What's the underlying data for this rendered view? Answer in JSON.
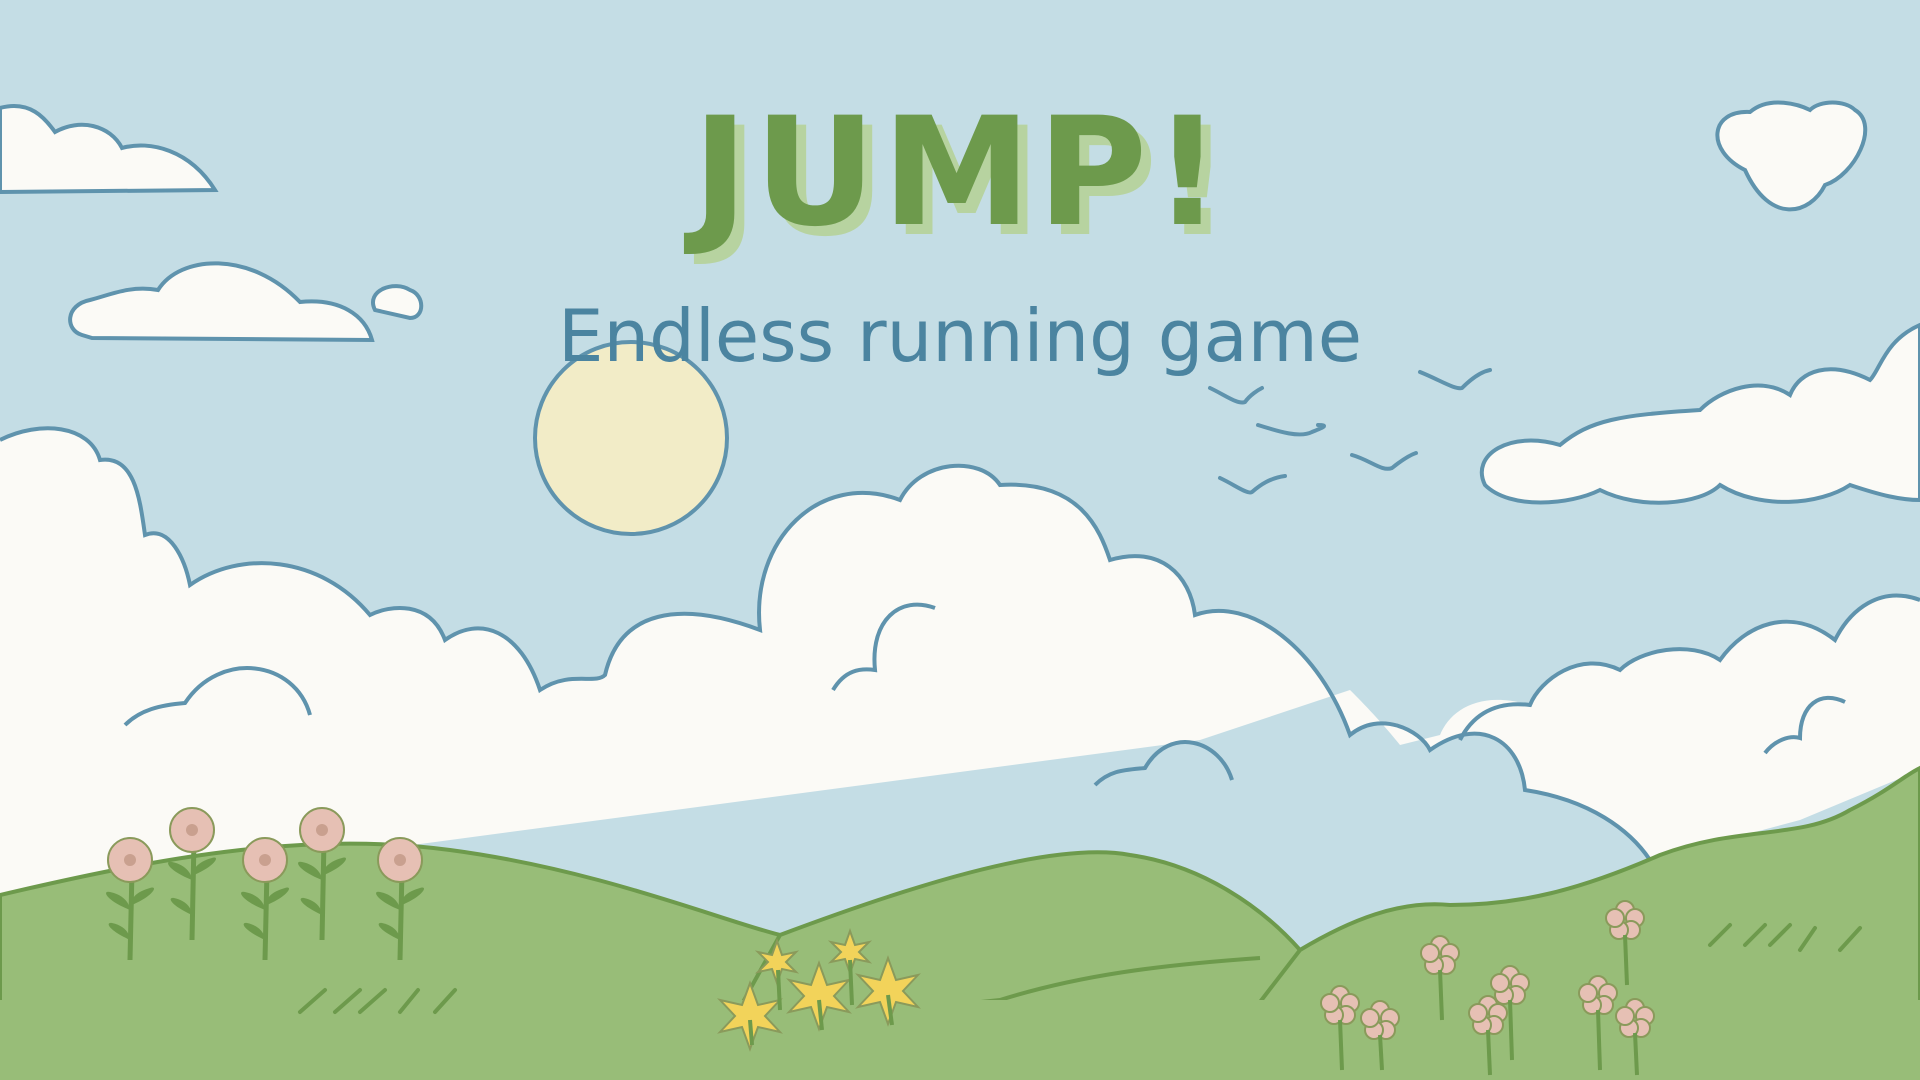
{
  "title": "JUMP!",
  "subtitle": "Endless running game",
  "colors": {
    "sky": "#c4dde5",
    "cloud_fill": "#fbfaf6",
    "outline": "#5f93ad",
    "sun": "#f2ecc7",
    "hill": "#98bd78",
    "hill_line": "#6d9a4c",
    "title": "#6d9a4c",
    "title_shadow": "#b7d3a0",
    "subtitle": "#4b84a0",
    "flower_pink": "#e6c0b4",
    "flower_yellow": "#f2d35a"
  },
  "icons": {
    "sun": "sun-icon",
    "birds": "bird-icon",
    "flowers": "flower-icon"
  }
}
